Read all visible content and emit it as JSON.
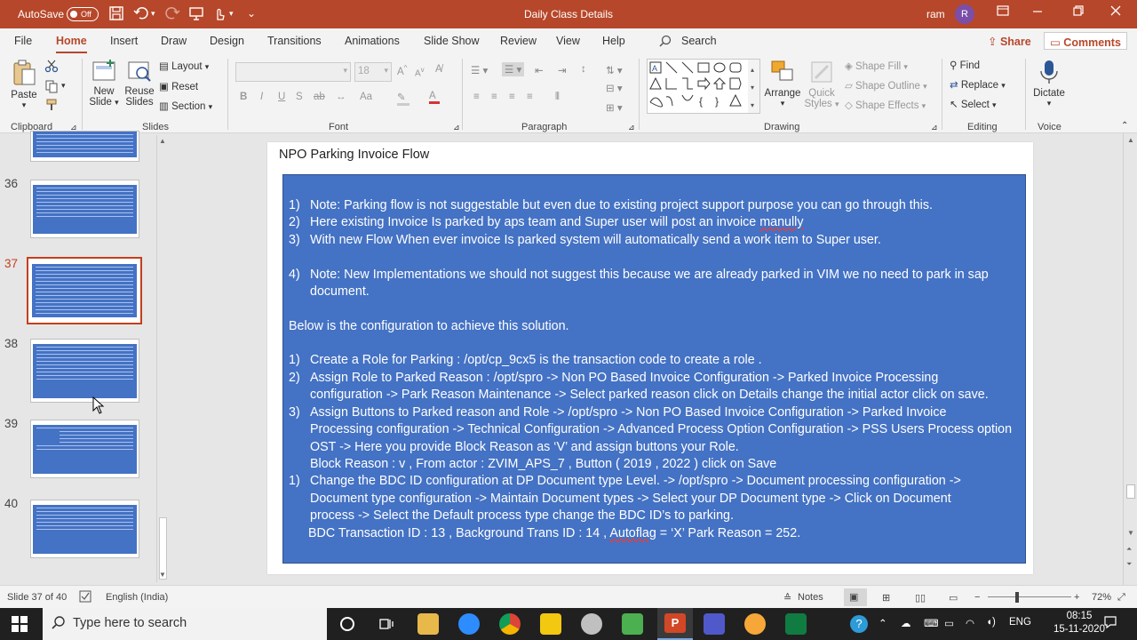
{
  "titlebar": {
    "autosave_label": "AutoSave",
    "autosave_state": "Off",
    "document_title": "Daily Class Details",
    "user_name": "ram",
    "user_initial": "R"
  },
  "tabs": [
    "File",
    "Home",
    "Insert",
    "Draw",
    "Design",
    "Transitions",
    "Animations",
    "Slide Show",
    "Review",
    "View",
    "Help"
  ],
  "active_tab": "Home",
  "search_label": "Search",
  "share_label": "Share",
  "comments_label": "Comments",
  "ribbon": {
    "clipboard": {
      "paste": "Paste",
      "group": "Clipboard"
    },
    "slides": {
      "new_slide_1": "New",
      "new_slide_2": "Slide",
      "reuse_1": "Reuse",
      "reuse_2": "Slides",
      "layout": "Layout",
      "reset": "Reset",
      "section": "Section",
      "group": "Slides"
    },
    "font": {
      "font_size": "18",
      "group": "Font"
    },
    "paragraph": {
      "group": "Paragraph"
    },
    "drawing": {
      "arrange": "Arrange",
      "quick_styles_1": "Quick",
      "quick_styles_2": "Styles",
      "shape_fill": "Shape Fill",
      "shape_outline": "Shape Outline",
      "shape_effects": "Shape Effects",
      "group": "Drawing"
    },
    "editing": {
      "find": "Find",
      "replace": "Replace",
      "select": "Select",
      "group": "Editing"
    },
    "voice": {
      "dictate": "Dictate",
      "group": "Voice"
    }
  },
  "thumbnails": [
    {
      "num": "36",
      "selected": false
    },
    {
      "num": "37",
      "selected": true
    },
    {
      "num": "38",
      "selected": false
    },
    {
      "num": "39",
      "selected": false
    },
    {
      "num": "40",
      "selected": false
    }
  ],
  "slide": {
    "title": "NPO Parking Invoice Flow",
    "lines": [
      {
        "num": "1)",
        "text": "Note: Parking flow is not suggestable but even due to existing project support purpose you can go through this."
      },
      {
        "num": "2)",
        "text": "Here existing Invoice Is parked by aps team and Super user will post an invoice ",
        "tail": "manully"
      },
      {
        "num": "3)",
        "text": "With new Flow When ever invoice Is parked system will automatically send a work item to Super user."
      },
      {
        "num": "4)",
        "text": "Note: New Implementations we should not suggest this because we are already parked in VIM we no need to park in sap"
      },
      {
        "num": "",
        "text": "document."
      },
      {
        "num": "",
        "text": "Below is the configuration to achieve this solution."
      },
      {
        "num": "1)",
        "text": "Create a Role for Parking : /opt/cp_9cx5 is the transaction code to create a role ."
      },
      {
        "num": "2)",
        "text": "Assign Role to Parked Reason : /opt/spro -> Non PO Based Invoice Configuration -> Parked Invoice Processing"
      },
      {
        "num": "",
        "text": "configuration -> Park Reason Maintenance ->  Select parked reason click on Details change the initial actor click on save."
      },
      {
        "num": "3)",
        "text": "Assign Buttons to Parked reason and Role -> /opt/spro -> Non PO Based Invoice Configuration -> Parked Invoice"
      },
      {
        "num": "",
        "text": "Processing configuration -> Technical Configuration -> Advanced Process Option Configuration -> PSS Users Process option"
      },
      {
        "num": "",
        "text": "OST -> Here you provide Block Reason as ‘V’ and assign buttons your Role."
      },
      {
        "num": "",
        "text": " Block Reason : v ,  From actor : ZVIM_APS_7 , Button ( 2019 , 2022 ) click on Save"
      },
      {
        "num": "1)",
        "text": "Change the BDC ID configuration at DP Document type Level. -> /opt/spro -> Document processing configuration ->"
      },
      {
        "num": "",
        "text": "Document type configuration -> Maintain Document types -> Select your DP Document type -> Click on Document"
      },
      {
        "num": "",
        "text": "process -> Select the Default process type change the BDC ID’s to parking."
      },
      {
        "num": "",
        "pre": "BDC Transaction ID : 13 , Background Trans ID : 14 , ",
        "tail": "Autoflag",
        "post": " = ‘X’ Park Reason = 252."
      }
    ]
  },
  "status": {
    "slide_info": "Slide 37 of 40",
    "language": "English (India)",
    "notes": "Notes",
    "zoom": "72%"
  },
  "taskbar": {
    "search_placeholder": "Type here to search",
    "lang": "ENG",
    "time": "08:15",
    "date": "15-11-2020"
  },
  "colors": {
    "accent": "#b7472a",
    "slide_box": "#4472c4",
    "selected_thumb": "#c43e1c"
  }
}
